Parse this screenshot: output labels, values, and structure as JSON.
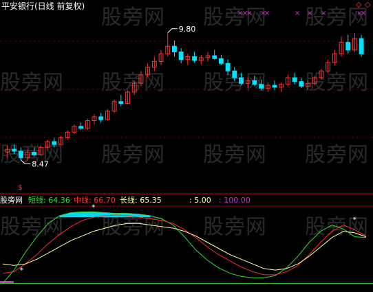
{
  "title": "平安银行(日线 前复权)",
  "watermark": "股旁网",
  "indicator_label": "股旁网",
  "colors": {
    "up": "#ff3333",
    "down": "#00e5ff",
    "short": "#33dd33",
    "mid": "#ff2a2a",
    "long": "#ffffa0",
    "axis": "#cc0000",
    "fill": "#00e5ff",
    "magenta": "#cc33cc"
  },
  "chart_data": [
    {
      "type": "candlestick",
      "title": "平安银行(日线 前复权)",
      "annotations": [
        {
          "label": "9.80",
          "kind": "high"
        },
        {
          "label": "8.47",
          "kind": "low"
        }
      ],
      "ylim": [
        8.2,
        10.0
      ],
      "candles": [
        [
          8.55,
          8.62,
          8.49,
          8.58
        ],
        [
          8.58,
          8.63,
          8.53,
          8.56
        ],
        [
          8.56,
          8.6,
          8.47,
          8.49
        ],
        [
          8.49,
          8.58,
          8.47,
          8.55
        ],
        [
          8.55,
          8.6,
          8.5,
          8.52
        ],
        [
          8.52,
          8.62,
          8.51,
          8.6
        ],
        [
          8.6,
          8.68,
          8.57,
          8.66
        ],
        [
          8.66,
          8.7,
          8.6,
          8.63
        ],
        [
          8.63,
          8.72,
          8.62,
          8.7
        ],
        [
          8.7,
          8.78,
          8.68,
          8.76
        ],
        [
          8.76,
          8.84,
          8.74,
          8.82
        ],
        [
          8.82,
          8.86,
          8.78,
          8.8
        ],
        [
          8.8,
          8.9,
          8.78,
          8.88
        ],
        [
          8.88,
          8.95,
          8.84,
          8.92
        ],
        [
          8.92,
          8.96,
          8.86,
          8.89
        ],
        [
          8.89,
          9.0,
          8.88,
          8.98
        ],
        [
          8.98,
          9.1,
          8.96,
          9.08
        ],
        [
          9.08,
          9.15,
          9.03,
          9.06
        ],
        [
          9.06,
          9.2,
          9.05,
          9.18
        ],
        [
          9.18,
          9.3,
          9.15,
          9.27
        ],
        [
          9.27,
          9.4,
          9.24,
          9.36
        ],
        [
          9.36,
          9.48,
          9.33,
          9.44
        ],
        [
          9.44,
          9.55,
          9.4,
          9.5
        ],
        [
          9.5,
          9.62,
          9.46,
          9.58
        ],
        [
          9.58,
          9.8,
          9.55,
          9.66
        ],
        [
          9.66,
          9.72,
          9.55,
          9.6
        ],
        [
          9.6,
          9.64,
          9.48,
          9.52
        ],
        [
          9.52,
          9.58,
          9.46,
          9.55
        ],
        [
          9.55,
          9.6,
          9.49,
          9.51
        ],
        [
          9.51,
          9.57,
          9.47,
          9.54
        ],
        [
          9.54,
          9.6,
          9.5,
          9.56
        ],
        [
          9.56,
          9.62,
          9.52,
          9.53
        ],
        [
          9.53,
          9.57,
          9.46,
          9.48
        ],
        [
          9.48,
          9.52,
          9.36,
          9.4
        ],
        [
          9.4,
          9.44,
          9.3,
          9.33
        ],
        [
          9.33,
          9.38,
          9.25,
          9.27
        ],
        [
          9.27,
          9.33,
          9.22,
          9.3
        ],
        [
          9.3,
          9.35,
          9.24,
          9.26
        ],
        [
          9.26,
          9.31,
          9.2,
          9.22
        ],
        [
          9.22,
          9.28,
          9.18,
          9.25
        ],
        [
          9.25,
          9.3,
          9.2,
          9.23
        ],
        [
          9.23,
          9.28,
          9.18,
          9.26
        ],
        [
          9.26,
          9.36,
          9.24,
          9.33
        ],
        [
          9.33,
          9.38,
          9.26,
          9.29
        ],
        [
          9.29,
          9.33,
          9.22,
          9.24
        ],
        [
          9.24,
          9.3,
          9.2,
          9.27
        ],
        [
          9.27,
          9.35,
          9.25,
          9.33
        ],
        [
          9.33,
          9.42,
          9.31,
          9.4
        ],
        [
          9.4,
          9.52,
          9.38,
          9.49
        ],
        [
          9.49,
          9.62,
          9.46,
          9.58
        ],
        [
          9.58,
          9.76,
          9.55,
          9.7
        ],
        [
          9.7,
          9.78,
          9.58,
          9.62
        ],
        [
          9.62,
          9.8,
          9.6,
          9.74
        ],
        [
          9.74,
          9.78,
          9.55,
          9.58
        ]
      ]
    },
    {
      "type": "line",
      "values_label": [
        {
          "name": "短线",
          "value": "64.36"
        },
        {
          "name": "中线",
          "value": "66.70"
        },
        {
          "name": "长线",
          "value": "65.35"
        }
      ],
      "levels": [
        {
          "value": "5.00"
        },
        {
          "value": "100.00"
        }
      ],
      "ylim": [
        0,
        100
      ],
      "series": [
        {
          "name": "短线",
          "values": [
            5,
            22,
            45,
            65,
            82,
            92,
            96,
            97,
            97,
            96,
            95,
            95,
            94,
            92,
            88,
            80,
            65,
            48,
            35,
            25,
            18,
            14,
            12,
            12,
            15,
            25,
            40,
            58,
            72,
            80,
            75,
            65,
            64
          ]
        },
        {
          "name": "中线",
          "values": [
            18,
            20,
            30,
            42,
            56,
            68,
            78,
            86,
            90,
            92,
            93,
            92,
            90,
            88,
            86,
            82,
            74,
            64,
            52,
            42,
            34,
            26,
            20,
            16,
            16,
            20,
            28,
            42,
            58,
            72,
            80,
            74,
            66
          ]
        },
        {
          "name": "长线",
          "values": [
            30,
            28,
            30,
            36,
            44,
            52,
            60,
            66,
            72,
            76,
            80,
            82,
            82,
            80,
            78,
            76,
            72,
            66,
            58,
            50,
            42,
            36,
            30,
            24,
            22,
            24,
            30,
            40,
            52,
            64,
            72,
            70,
            65
          ]
        }
      ]
    }
  ]
}
